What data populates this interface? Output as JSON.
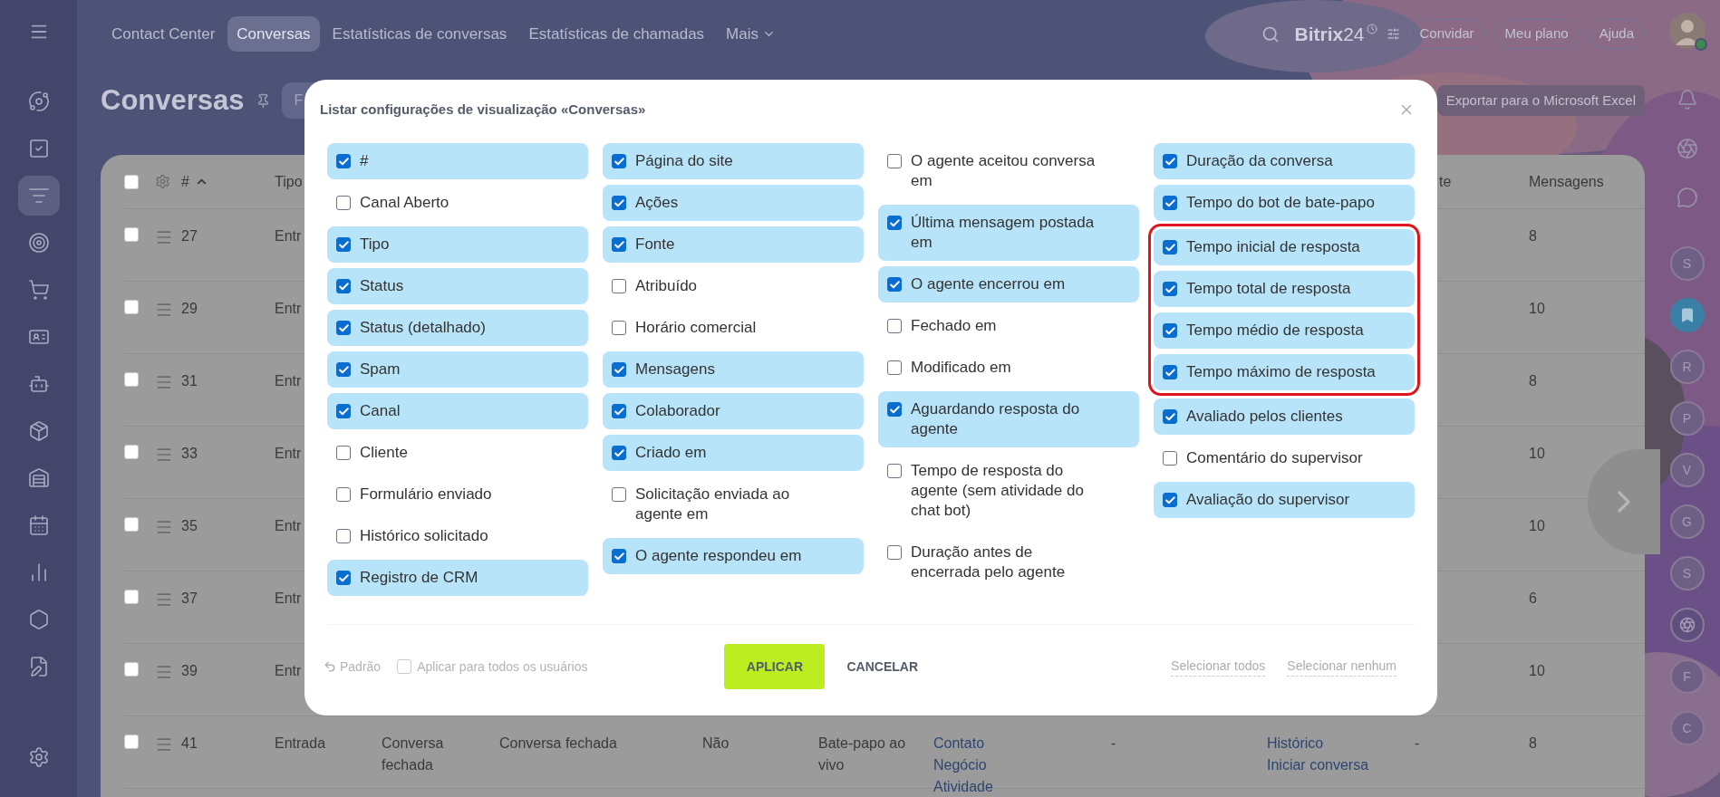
{
  "topbar": {
    "tabs": [
      {
        "label": "Contact Center",
        "selected": false
      },
      {
        "label": "Conversas",
        "selected": true
      },
      {
        "label": "Estatísticas de conversas",
        "selected": false
      },
      {
        "label": "Estatísticas de chamadas",
        "selected": false
      },
      {
        "label": "Mais",
        "selected": false
      }
    ],
    "logo": "Bitrix",
    "logo_suffix": "24",
    "buttons": [
      "Convidar",
      "Meu plano",
      "Ajuda"
    ]
  },
  "left_sidebar": {
    "items": [
      {
        "selected": false
      },
      {
        "selected": false
      },
      {
        "selected": true
      },
      {
        "selected": false
      },
      {
        "selected": false
      },
      {
        "selected": false
      },
      {
        "selected": false
      },
      {
        "selected": false
      },
      {
        "selected": false
      },
      {
        "selected": false
      },
      {
        "selected": false
      },
      {
        "selected": false
      },
      {
        "selected": false
      }
    ]
  },
  "page": {
    "title": "Conversas",
    "filter_placeholder": "F",
    "export_button": "Exportar para o Microsoft Excel"
  },
  "table": {
    "header": {
      "checked": false,
      "id": "#",
      "tipo": "Tipo",
      "column_10": "te",
      "mensagens": "Mensagens"
    },
    "rows": [
      {
        "checked": false,
        "id": "27",
        "tipo": "Entr",
        "mensagens": "8"
      },
      {
        "checked": false,
        "id": "29",
        "tipo": "Entr",
        "mensagens": "10"
      },
      {
        "checked": false,
        "id": "31",
        "tipo": "Entr",
        "mensagens": "8"
      },
      {
        "checked": false,
        "id": "33",
        "tipo": "Entr",
        "mensagens": "10"
      },
      {
        "checked": false,
        "id": "35",
        "tipo": "Entr",
        "mensagens": "10"
      },
      {
        "checked": false,
        "id": "37",
        "tipo": "Entr",
        "mensagens": "6"
      },
      {
        "checked": false,
        "id": "39",
        "tipo": "Entr",
        "mensagens": "10"
      },
      {
        "checked": false,
        "id": "41",
        "tipo": "Entrada",
        "column_3": "Conversa fechada",
        "column_4": "Conversa fechada",
        "column_5": "Não",
        "column_6": "Bate-papo ao vivo",
        "column_7": [
          "Contato",
          "Negócio",
          "Atividade"
        ],
        "column_8": "-",
        "column_9": [
          "Histórico",
          "Iniciar conversa"
        ],
        "column_10": "-",
        "mensagens": "8"
      }
    ]
  },
  "right_sidebar": {
    "items": [
      {
        "kind": "letter",
        "label": "S"
      },
      {
        "kind": "bookmark"
      },
      {
        "kind": "letter",
        "label": "R"
      },
      {
        "kind": "letter",
        "label": "P"
      },
      {
        "kind": "letter",
        "label": "V"
      },
      {
        "kind": "letter",
        "label": "G"
      },
      {
        "kind": "letter",
        "label": "S"
      },
      {
        "kind": "swirl"
      },
      {
        "kind": "letter",
        "label": "F"
      },
      {
        "kind": "letter",
        "label": "C"
      }
    ]
  },
  "dialog": {
    "title": "Listar configurações de visualização «Conversas»",
    "columns": [
      [
        {
          "kind": "option",
          "label": "#",
          "checked": true
        },
        {
          "kind": "option",
          "label": "Canal Aberto",
          "checked": false
        },
        {
          "kind": "option",
          "label": "Tipo",
          "checked": true
        },
        {
          "kind": "option",
          "label": "Status",
          "checked": true
        },
        {
          "kind": "option",
          "label": "Status (detalhado)",
          "checked": true
        },
        {
          "kind": "option",
          "label": "Spam",
          "checked": true
        },
        {
          "kind": "option",
          "label": "Canal",
          "checked": true
        },
        {
          "kind": "option",
          "label": "Cliente",
          "checked": false
        },
        {
          "kind": "option",
          "label": "Formulário enviado",
          "checked": false
        },
        {
          "kind": "option",
          "label": "Histórico solicitado",
          "checked": false
        },
        {
          "kind": "option",
          "label": "Registro de CRM",
          "checked": true
        }
      ],
      [
        {
          "kind": "option",
          "label": "Página do site",
          "checked": true
        },
        {
          "kind": "option",
          "label": "Ações",
          "checked": true
        },
        {
          "kind": "option",
          "label": "Fonte",
          "checked": true
        },
        {
          "kind": "option",
          "label": "Atribuído",
          "checked": false
        },
        {
          "kind": "option",
          "label": "Horário comercial",
          "checked": false
        },
        {
          "kind": "option",
          "label": "Mensagens",
          "checked": true
        },
        {
          "kind": "option",
          "label": "Colaborador",
          "checked": true
        },
        {
          "kind": "option",
          "label": "Criado em",
          "checked": true
        },
        {
          "kind": "option",
          "label": "Solicitação enviada ao agente em",
          "checked": false
        },
        {
          "kind": "option",
          "label": "O agente respondeu em",
          "checked": true
        }
      ],
      [
        {
          "kind": "option",
          "label": "O agente aceitou conversa em",
          "checked": false
        },
        {
          "kind": "option",
          "label": "Última mensagem postada em",
          "checked": true
        },
        {
          "kind": "option",
          "label": "O agente encerrou em",
          "checked": true
        },
        {
          "kind": "option",
          "label": "Fechado em",
          "checked": false
        },
        {
          "kind": "option",
          "label": "Modificado em",
          "checked": false
        },
        {
          "kind": "option",
          "label": "Aguardando resposta do agente",
          "checked": true
        },
        {
          "kind": "option",
          "label": "Tempo de resposta do agente (sem atividade do chat bot)",
          "checked": false
        },
        {
          "kind": "option",
          "label": "Duração antes de encerrada pelo agente",
          "checked": false
        }
      ],
      [
        {
          "kind": "option",
          "label": "Duração da conversa",
          "checked": true
        },
        {
          "kind": "option",
          "label": "Tempo do bot de bate-papo",
          "checked": true
        },
        {
          "kind": "highlight",
          "items": [
            {
              "kind": "option",
              "label": "Tempo inicial de resposta",
              "checked": true
            },
            {
              "kind": "option",
              "label": "Tempo total de resposta",
              "checked": true
            },
            {
              "kind": "option",
              "label": "Tempo médio de resposta",
              "checked": true
            },
            {
              "kind": "option",
              "label": "Tempo máximo de resposta",
              "checked": true
            }
          ]
        },
        {
          "kind": "option",
          "label": "Avaliado pelos clientes",
          "checked": true
        },
        {
          "kind": "option",
          "label": "Comentário do supervisor",
          "checked": false
        },
        {
          "kind": "option",
          "label": "Avaliação do supervisor",
          "checked": true
        }
      ]
    ],
    "footer": {
      "reset": "Padrão",
      "apply_all": {
        "label": "Aplicar para todos os usuários",
        "checked": false
      },
      "apply": "APLICAR",
      "cancel": "CANCELAR",
      "select_all": "Selecionar todos",
      "select_none": "Selecionar nenhum"
    }
  }
}
